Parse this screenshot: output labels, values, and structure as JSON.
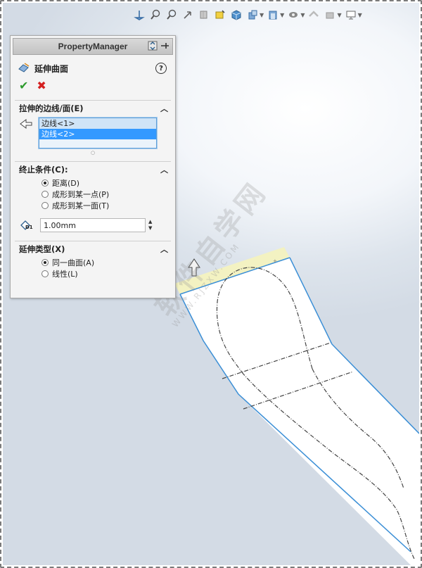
{
  "property_manager": {
    "header_title": "PropertyManager",
    "feature_title": "延伸曲面",
    "help_symbol": "?",
    "ok_symbol": "✔",
    "cancel_symbol": "✖",
    "groups": {
      "edges": {
        "title": "拉伸的边线/面(E)",
        "items": [
          "边线<1>",
          "边线<2>"
        ],
        "selected_index": 1
      },
      "end_condition": {
        "title": "终止条件(C):",
        "options": [
          "距离(D)",
          "成形到某一点(P)",
          "成形到某一面(T)"
        ],
        "selected_index": 0,
        "distance_value": "1.00mm",
        "distance_icon_label": "D1"
      },
      "extension_type": {
        "title": "延伸类型(X)",
        "options": [
          "同一曲面(A)",
          "线性(L)"
        ],
        "selected_index": 0
      }
    }
  },
  "watermark": {
    "main": "软件自学网",
    "sub": "WWW.RJZXW.COM"
  },
  "colors": {
    "edge_blue": "#3b8fd6",
    "highlight_yellow": "#f4f3c4",
    "selection_blue": "#3399ff"
  }
}
